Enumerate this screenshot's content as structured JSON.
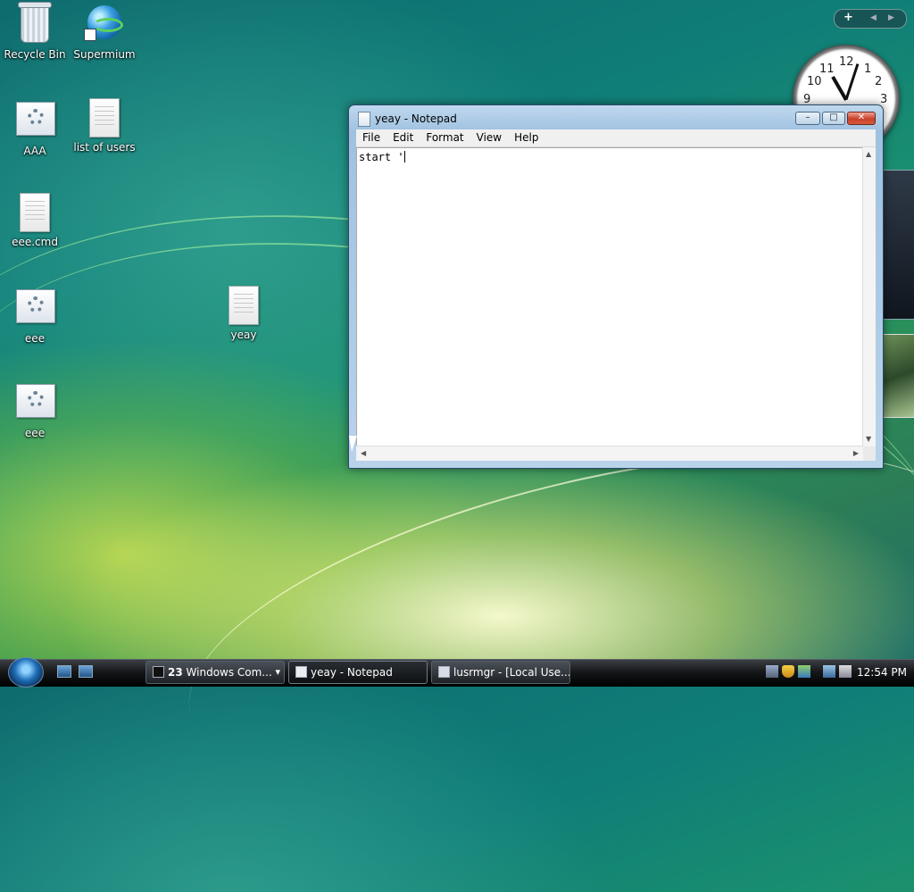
{
  "desktop": {
    "icons": [
      {
        "label": "Recycle Bin",
        "icon": "recycle-bin-icon"
      },
      {
        "label": "Supermium",
        "icon": "browser-icon"
      },
      {
        "label": "AAA",
        "icon": "script-file-icon"
      },
      {
        "label": "list of users",
        "icon": "text-file-icon"
      },
      {
        "label": "eee.cmd",
        "icon": "text-file-icon"
      },
      {
        "label": "eee",
        "icon": "script-file-icon"
      },
      {
        "label": "yeay",
        "icon": "text-file-icon"
      },
      {
        "label": "eee",
        "icon": "script-file-icon"
      }
    ]
  },
  "gadgets": {
    "add": "+",
    "prev": "◀",
    "next": "▶",
    "clock_numbers": [
      "12",
      "1",
      "2",
      "3",
      "9",
      "10",
      "11"
    ]
  },
  "notepad": {
    "title": "yeay - Notepad",
    "minimize": "–",
    "maximize": "□",
    "close": "✕",
    "menu": [
      "File",
      "Edit",
      "Format",
      "View",
      "Help"
    ],
    "content": "start '"
  },
  "taskbar": {
    "buttons": [
      {
        "count": "23",
        "label": "Windows Com...",
        "icon": "command-prompt-icon"
      },
      {
        "label": "yeay - Notepad",
        "icon": "notepad-icon",
        "active": true
      },
      {
        "label": "lusrmgr - [Local Use...",
        "icon": "management-console-icon"
      }
    ],
    "dropdown_arrow": "▾",
    "time": "12:54 PM"
  },
  "colors": {
    "taskbar": "#151719",
    "titlebar": "#bfd8ee",
    "close_button": "#c8402a"
  }
}
